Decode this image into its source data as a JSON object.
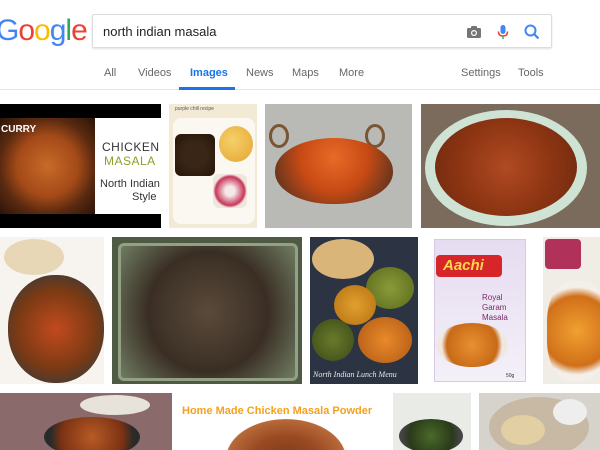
{
  "logo": {
    "letters": [
      "G",
      "o",
      "o",
      "g",
      "l",
      "e"
    ],
    "colors": [
      "#4285f4",
      "#ea4335",
      "#fbbc05",
      "#4285f4",
      "#34a853",
      "#ea4335"
    ]
  },
  "search": {
    "query": "north indian masala",
    "camera_icon": "camera-icon",
    "mic_icon": "microphone-icon",
    "search_icon": "search-icon",
    "accent": "#4285f4"
  },
  "tabs": [
    {
      "label": "All",
      "active": false
    },
    {
      "label": "Videos",
      "active": false
    },
    {
      "label": "Images",
      "active": true
    },
    {
      "label": "News",
      "active": false
    },
    {
      "label": "Maps",
      "active": false
    },
    {
      "label": "More",
      "active": false
    }
  ],
  "settings_label": "Settings",
  "tools_label": "Tools",
  "images": {
    "t1": {
      "top_label": "CURRY",
      "line1": "CHICKEN",
      "line2": "MASALA",
      "line3": "North Indian",
      "line4": "Style"
    },
    "t2": {
      "note": "purple chili recipe"
    },
    "t7": {
      "caption": "North Indian Lunch Menu"
    },
    "t8": {
      "brand": "Aachi",
      "line1": "Royal",
      "line2": "Garam",
      "line3": "Masala",
      "weight": "50g"
    },
    "t11": {
      "caption": "Home Made Chicken Masala Powder"
    }
  }
}
